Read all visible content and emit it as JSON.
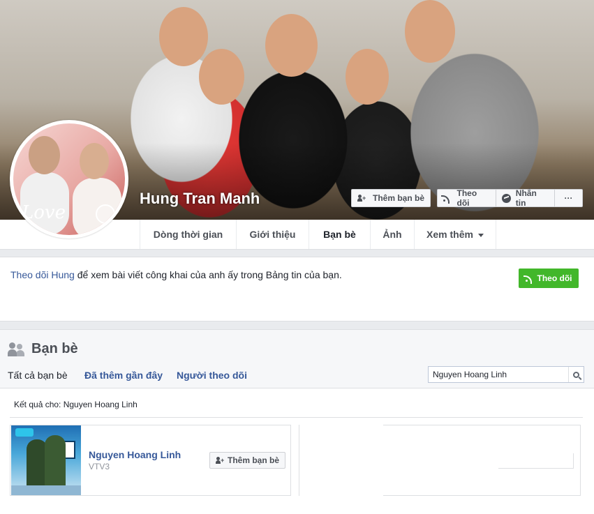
{
  "profile": {
    "name": "Hung Tran Manh",
    "avatar_text": "Love"
  },
  "cover_actions": {
    "add_friend": "Thêm bạn bè",
    "follow": "Theo dõi",
    "message": "Nhắn tin",
    "more": "···"
  },
  "nav": {
    "tabs": [
      {
        "label": "Dòng thời gian"
      },
      {
        "label": "Giới thiệu"
      },
      {
        "label": "Bạn bè"
      },
      {
        "label": "Ảnh"
      },
      {
        "label": "Xem thêm"
      }
    ]
  },
  "follow_panel": {
    "link_text": "Theo dõi Hung",
    "rest_text": " để xem bài viết công khai của anh ấy trong Bảng tin của bạn.",
    "button": "Theo dõi"
  },
  "friends": {
    "title": "Bạn bè",
    "tabs": [
      {
        "label": "Tất cả bạn bè"
      },
      {
        "label": "Đã thêm gần đây"
      },
      {
        "label": "Người theo dõi"
      }
    ],
    "search_value": "Nguyen Hoang Linh",
    "results_label": "Kết quả cho: Nguyen Hoang Linh",
    "results": [
      {
        "name": "Nguyen Hoang Linh",
        "subtitle": "VTV3",
        "button": "Thêm bạn bè"
      }
    ]
  },
  "colors": {
    "link": "#365899",
    "green": "#42b72a",
    "background": "#e9ebee"
  }
}
